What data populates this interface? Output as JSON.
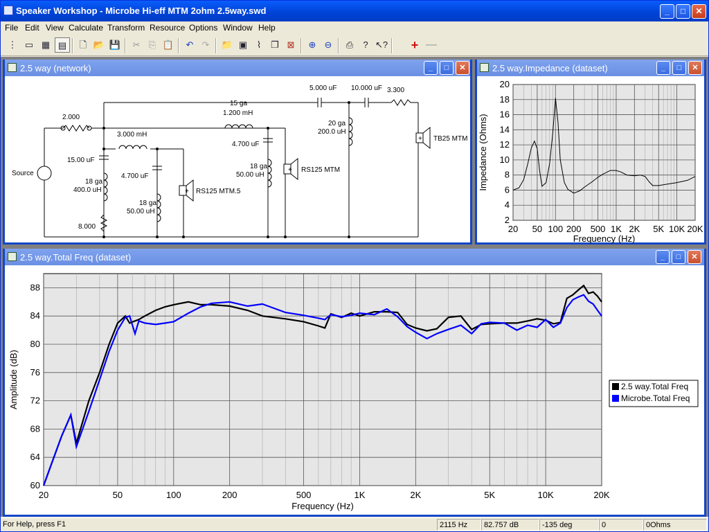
{
  "app": {
    "title": "Speaker Workshop - Microbe Hi-eff MTM 2ohm 2.5way.swd"
  },
  "menu": [
    "File",
    "Edit",
    "View",
    "Calculate",
    "Transform",
    "Resource",
    "Options",
    "Window",
    "Help"
  ],
  "network": {
    "title": "2.5 way (network)",
    "labels": {
      "r_source": "2.000",
      "source": "Source",
      "c1": "15.00 uF",
      "l1a": "18 ga",
      "l1b": "400.0 uH",
      "r1": "8.000",
      "l2": "3.000 mH",
      "c2": "4.700 uF",
      "l3a": "18 ga",
      "l3b": "50.00 uH",
      "spk1": "RS125 MTM.5",
      "l4a": "15 ga",
      "l4b": "1.200 mH",
      "c3": "4.700 uF",
      "l5a": "18 ga",
      "l5b": "50.00 uH",
      "spk2": "RS125 MTM",
      "c4": "5.000 uF",
      "l6a": "20 ga",
      "l6b": "200.0 uH",
      "c5": "10.000 uF",
      "r2": "3.300",
      "spk3": "TB25 MTM"
    }
  },
  "impedance": {
    "title": "2.5 way.Impedance (dataset)"
  },
  "freq": {
    "title": "2.5 way.Total Freq (dataset)"
  },
  "status": {
    "help": "For Help, press F1",
    "freq": "2115 Hz",
    "db": "82.757 dB",
    "deg": "-135 deg",
    "val": "0",
    "ohms": "0Ohms"
  },
  "chart_data": [
    {
      "type": "line",
      "title": "",
      "xlabel": "Frequency (Hz)",
      "ylabel": "Impedance (Ohms)",
      "xscale": "log",
      "xlim": [
        20,
        20000
      ],
      "ylim": [
        2,
        20
      ],
      "xticks": [
        "20",
        "50",
        "100",
        "200",
        "500",
        "1K",
        "2K",
        "5K",
        "10K",
        "20K"
      ],
      "yticks": [
        "2",
        "4",
        "6",
        "8",
        "10",
        "12",
        "14",
        "16",
        "18",
        "20"
      ],
      "series": [
        {
          "x": [
            20,
            25,
            30,
            35,
            40,
            45,
            50,
            55,
            60,
            70,
            80,
            90,
            100,
            110,
            120,
            140,
            160,
            200,
            250,
            300,
            400,
            500,
            600,
            800,
            1000,
            1200,
            1500,
            2000,
            2500,
            3000,
            3500,
            4000,
            5000,
            7000,
            10000,
            15000,
            20000
          ],
          "y": [
            6.0,
            6.3,
            7.4,
            9.5,
            11.6,
            12.5,
            11.5,
            8.5,
            6.5,
            7.0,
            9.5,
            13.5,
            18.2,
            15.0,
            10.0,
            7.0,
            6.1,
            5.6,
            5.9,
            6.4,
            7.1,
            7.7,
            8.1,
            8.6,
            8.6,
            8.4,
            8.0,
            7.9,
            8.0,
            7.8,
            7.1,
            6.6,
            6.6,
            6.8,
            7.0,
            7.3,
            7.8
          ]
        }
      ],
      "grid": true
    },
    {
      "type": "line",
      "title": "",
      "xlabel": "Frequency (Hz)",
      "ylabel": "Amplitude (dB)",
      "xscale": "log",
      "xlim": [
        20,
        20000
      ],
      "ylim": [
        60,
        90
      ],
      "xticks": [
        "20",
        "50",
        "100",
        "200",
        "500",
        "1K",
        "2K",
        "5K",
        "10K",
        "20K"
      ],
      "yticks": [
        "60",
        "64",
        "68",
        "72",
        "76",
        "80",
        "84",
        "88"
      ],
      "legend": "right",
      "series": [
        {
          "name": "2.5 way.Total Freq",
          "color": "#000000",
          "x": [
            20,
            22,
            25,
            28,
            30,
            35,
            40,
            45,
            50,
            55,
            58,
            62,
            65,
            70,
            80,
            90,
            100,
            120,
            140,
            160,
            200,
            250,
            300,
            400,
            500,
            600,
            650,
            700,
            800,
            900,
            1000,
            1200,
            1400,
            1600,
            1800,
            2000,
            2300,
            2600,
            3000,
            3500,
            4000,
            4500,
            5000,
            6000,
            7000,
            8000,
            9000,
            10000,
            11000,
            12000,
            13000,
            14000,
            15000,
            16000,
            17000,
            18000,
            19000,
            20000
          ],
          "y": [
            60,
            63,
            67,
            70,
            66,
            72,
            76,
            80,
            83,
            84,
            83,
            83.3,
            83.5,
            84,
            84.8,
            85.3,
            85.6,
            86,
            85.6,
            85.6,
            85.4,
            84.8,
            84,
            83.6,
            83.2,
            82.6,
            82.3,
            84.3,
            83.8,
            84.4,
            84.0,
            84.6,
            84.6,
            84.5,
            82.8,
            82.3,
            81.9,
            82.2,
            83.8,
            84.0,
            82.1,
            82.8,
            82.9,
            83.0,
            83.0,
            83.3,
            83.6,
            83.4,
            82.9,
            83.1,
            86.5,
            87.0,
            87.7,
            88.3,
            87.2,
            87.4,
            86.8,
            86.0
          ]
        },
        {
          "name": "Microbe.Total Freq",
          "color": "#0000ff",
          "x": [
            20,
            22,
            25,
            28,
            30,
            35,
            40,
            45,
            50,
            55,
            58,
            62,
            65,
            70,
            80,
            90,
            100,
            120,
            140,
            160,
            200,
            250,
            300,
            400,
            500,
            600,
            650,
            700,
            800,
            900,
            1000,
            1200,
            1400,
            1600,
            1800,
            2000,
            2300,
            2600,
            3000,
            3500,
            4000,
            4500,
            5000,
            6000,
            7000,
            8000,
            9000,
            10000,
            11000,
            12000,
            13000,
            14000,
            15000,
            16000,
            17000,
            18000,
            19000,
            20000
          ],
          "y": [
            60,
            63,
            67,
            70,
            65.5,
            70.5,
            75,
            79,
            82,
            83.8,
            84,
            81.5,
            83.3,
            83,
            82.8,
            83,
            83.2,
            84.4,
            85.3,
            85.8,
            86,
            85.4,
            85.7,
            84.5,
            84.1,
            83.7,
            83.5,
            84.2,
            83.9,
            84.1,
            84.4,
            84.2,
            85.0,
            83.9,
            82.5,
            81.7,
            80.8,
            81.5,
            82.1,
            82.7,
            81.5,
            82.9,
            83.1,
            83.0,
            82.0,
            82.7,
            82.4,
            83.5,
            82.4,
            83.0,
            85.2,
            86.3,
            86.7,
            87.0,
            86.1,
            85.7,
            84.8,
            84.0
          ]
        }
      ],
      "grid": true
    }
  ]
}
